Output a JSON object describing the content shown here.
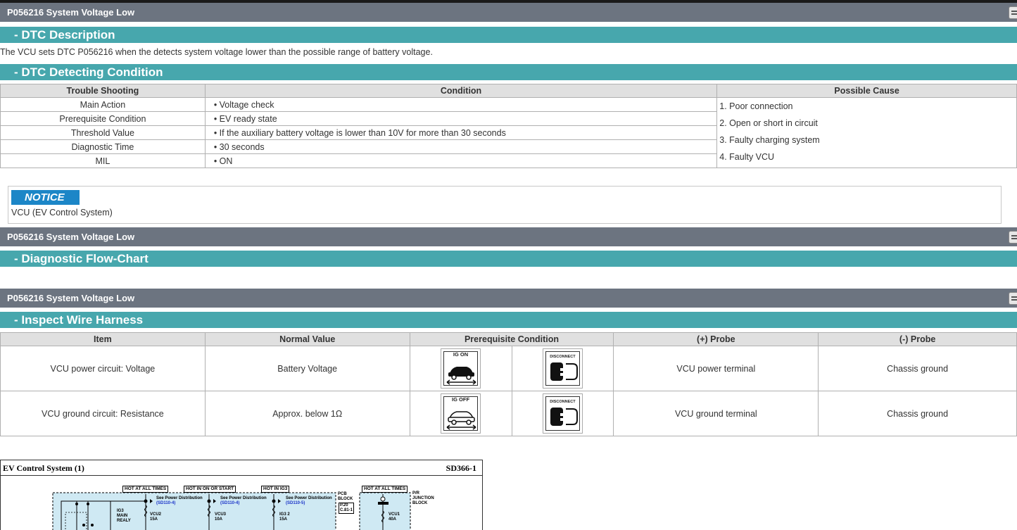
{
  "colors": {
    "grey_bar": "#6c7480",
    "teal_bar": "#47a7ad",
    "notice": "#1c86c7",
    "wiring_fill": "#cfe9f3"
  },
  "section1": {
    "bar_title": "P056216 System Voltage Low",
    "dtc_heading": "- DTC Description",
    "dtc_text": "The VCU sets DTC P056216 when the detects system voltage lower than the possible range of battery voltage.",
    "condition_heading": "- DTC Detecting Condition",
    "table": {
      "headers": [
        "Trouble Shooting",
        "Condition",
        "Possible Cause"
      ],
      "rows": [
        {
          "label": "Main Action",
          "condition": "• Voltage check"
        },
        {
          "label": "Prerequisite Condition",
          "condition": "• EV ready state"
        },
        {
          "label": "Threshold Value",
          "condition": "• If the auxiliary battery voltage is lower than 10V for more than 30 seconds"
        },
        {
          "label": "Diagnostic Time",
          "condition": "• 30 seconds"
        },
        {
          "label": "MIL",
          "condition": "• ON"
        }
      ],
      "causes": [
        "1. Poor connection",
        "2. Open or short in circuit",
        "3. Faulty charging system",
        "4. Faulty VCU"
      ]
    },
    "notice": {
      "badge": "NOTICE",
      "text": "VCU (EV Control System)"
    }
  },
  "section2": {
    "bar_title": "P056216 System Voltage Low",
    "heading": "- Diagnostic Flow-Chart"
  },
  "section3": {
    "bar_title": "P056216 System Voltage Low",
    "heading": "- Inspect Wire Harness",
    "table": {
      "headers": [
        "Item",
        "Normal Value",
        "Prerequisite Condition",
        "(+) Probe",
        "(-) Probe"
      ],
      "rows": [
        {
          "item": "VCU power circuit: Voltage",
          "normal": "Battery Voltage",
          "ig_label": "IG ON",
          "ig_icon": "ig-on-car-icon",
          "conn_label": "DISCONNECT",
          "conn_icon": "connector-disconnect-icon",
          "plus_probe": "VCU power terminal",
          "minus_probe": "Chassis ground"
        },
        {
          "item": "VCU ground circuit: Resistance",
          "normal": "Approx. below 1Ω",
          "ig_label": "IG OFF",
          "ig_icon": "ig-off-car-icon",
          "conn_label": "DISCONNECT",
          "conn_icon": "connector-disconnect-icon",
          "plus_probe": "VCU ground terminal",
          "minus_probe": "Chassis ground"
        }
      ]
    }
  },
  "wiring": {
    "title": "EV Control System (1)",
    "code": "SD366-1",
    "tags": [
      "HOT AT ALL TIMES",
      "HOT IN ON OR START",
      "HOT IN IG3",
      "HOT AT ALL TIMES"
    ],
    "see_label": "See Power Distribution",
    "refs": [
      "(SD110-4)",
      "(SD110-4)",
      "(SD110-5)"
    ],
    "fuses": [
      {
        "name": "VCU2",
        "amp": "15A"
      },
      {
        "name": "VCU3",
        "amp": "10A"
      },
      {
        "name": "IG3 2",
        "amp": "15A"
      },
      {
        "name": "VCU1",
        "amp": "40A"
      }
    ],
    "relay": [
      "IG3",
      "MAIN",
      "REALY"
    ],
    "pcb": [
      "PCB",
      "BLOCK"
    ],
    "pcb_ref": [
      "P.20",
      "C.81-1"
    ],
    "junction": [
      "P/R",
      "JUNCTION",
      "BLOCK"
    ]
  }
}
